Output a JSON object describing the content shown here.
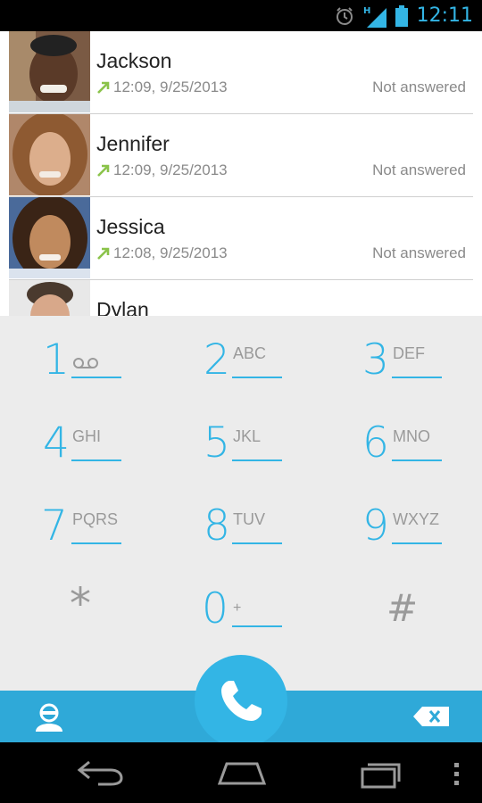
{
  "status_bar": {
    "time": "12:11",
    "network": "H",
    "icons": [
      "alarm-icon",
      "signal-icon",
      "battery-icon"
    ]
  },
  "call_log": [
    {
      "name": "Jackson",
      "time": "12:09, 9/25/2013",
      "status": "Not answered"
    },
    {
      "name": "Jennifer",
      "time": "12:09, 9/25/2013",
      "status": "Not answered"
    },
    {
      "name": "Jessica",
      "time": "12:08, 9/25/2013",
      "status": "Not answered"
    },
    {
      "name": "Dylan"
    }
  ],
  "dialpad": {
    "keys": [
      {
        "digit": "1",
        "letters": ""
      },
      {
        "digit": "2",
        "letters": "ABC"
      },
      {
        "digit": "3",
        "letters": "DEF"
      },
      {
        "digit": "4",
        "letters": "GHI"
      },
      {
        "digit": "5",
        "letters": "JKL"
      },
      {
        "digit": "6",
        "letters": "MNO"
      },
      {
        "digit": "7",
        "letters": "PQRS"
      },
      {
        "digit": "8",
        "letters": "TUV"
      },
      {
        "digit": "9",
        "letters": "WXYZ"
      },
      {
        "digit": "*",
        "letters": ""
      },
      {
        "digit": "0",
        "letters": "+"
      },
      {
        "digit": "#",
        "letters": ""
      }
    ]
  },
  "colors": {
    "accent": "#33b5e5",
    "action_bar": "#2fa9d8",
    "outgoing_arrow": "#8bc34a",
    "dialpad_bg": "#ececec"
  }
}
